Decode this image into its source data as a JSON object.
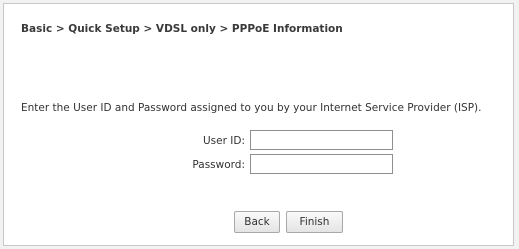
{
  "breadcrumb": "Basic > Quick Setup > VDSL only > PPPoE Information",
  "instructions": "Enter the User ID and Password assigned to you by your Internet Service Provider (ISP).",
  "form": {
    "user_id_label": "User ID:",
    "user_id_value": "",
    "password_label": "Password:",
    "password_value": ""
  },
  "buttons": {
    "back": "Back",
    "finish": "Finish"
  }
}
